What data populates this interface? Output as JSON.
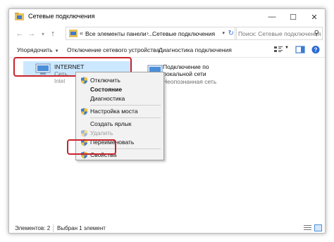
{
  "window": {
    "title": "Сетевые подключения",
    "minimize": "—",
    "maximize": "☐",
    "close": "✕"
  },
  "address": {
    "part1": "Все элементы панели ...",
    "separator": "›",
    "part2": "Сетевые подключения",
    "prefix": "«",
    "search_placeholder": "Поиск: Сетевые подключения"
  },
  "nav": {
    "back": "←",
    "forward": "→",
    "dropdown": "▾",
    "up": "↑"
  },
  "cmdbar": {
    "organize": "Упорядочить",
    "disable_device": "Отключение сетевого устройства",
    "diagnose": "Диагностика подключения",
    "dropdown_glyph": "▼"
  },
  "items": [
    {
      "name": "INTERNET",
      "sub": "Сеть",
      "ghost": "Intel"
    },
    {
      "name": "Подключение по",
      "name2": "локальной сети",
      "sub": "Неопознанная сеть"
    }
  ],
  "context_menu": [
    {
      "label": "Отключить",
      "shield": true,
      "bold": false,
      "disabled": false
    },
    {
      "label": "Состояние",
      "shield": false,
      "bold": true,
      "disabled": false
    },
    {
      "label": "Диагностика",
      "shield": false,
      "bold": false,
      "disabled": false
    },
    {
      "label": "Настройка моста",
      "shield": true,
      "bold": false,
      "disabled": false
    },
    {
      "label": "Создать ярлык",
      "shield": false,
      "bold": false,
      "disabled": false
    },
    {
      "label": "Удалить",
      "shield": true,
      "bold": false,
      "disabled": true
    },
    {
      "label": "Переименовать",
      "shield": true,
      "bold": false,
      "disabled": false
    },
    {
      "label": "Свойства",
      "shield": true,
      "bold": false,
      "disabled": false
    }
  ],
  "status": {
    "count": "Элементов: 2",
    "selected": "Выбран 1 элемент"
  },
  "colors": {
    "highlight": "#c8232c",
    "selection": "#cce8ff",
    "menu_bg": "#f2f2f2"
  }
}
